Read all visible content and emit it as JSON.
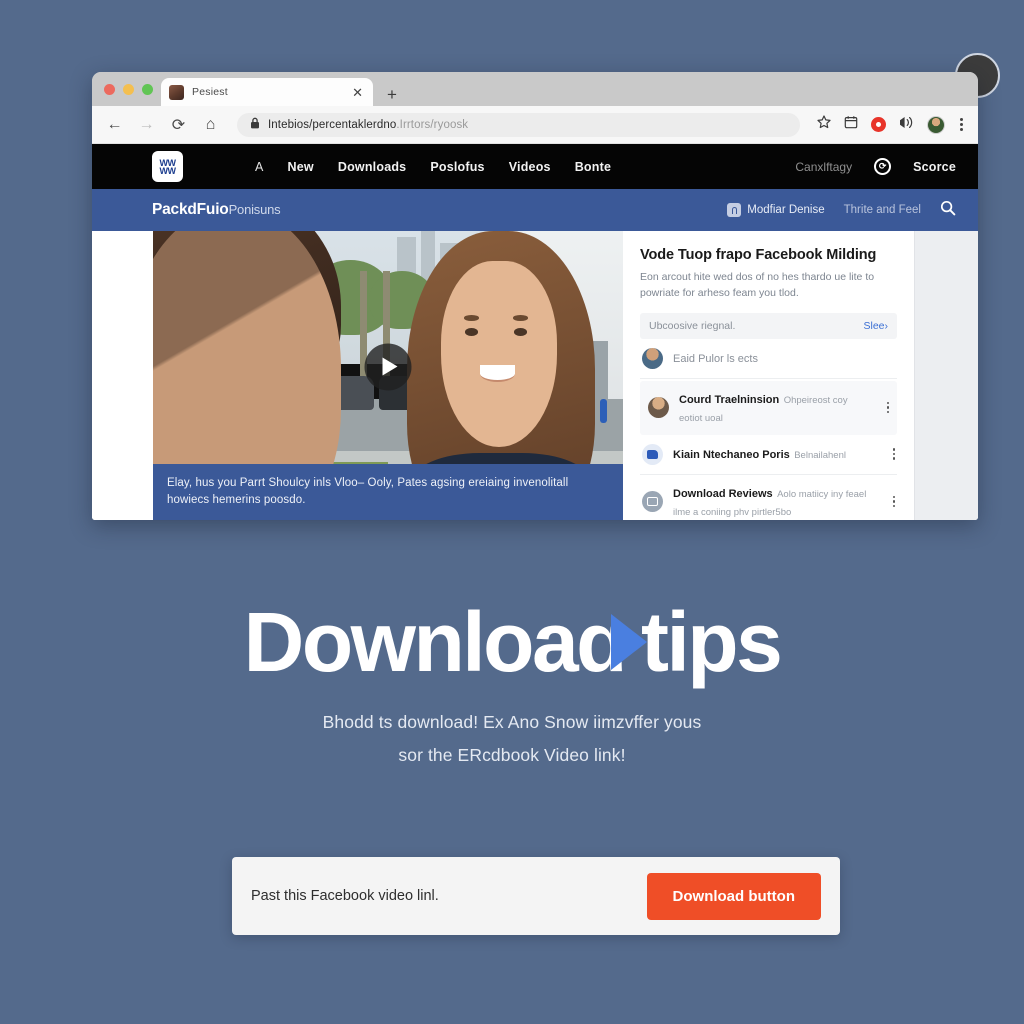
{
  "theme": {
    "page_bg": "#546A8C",
    "facebook_blue": "#3b5998",
    "accent_orange": "#ef4e27",
    "play_triangle_blue": "#4a7fe0",
    "link_blue": "#3b6fd4"
  },
  "browser": {
    "tab": {
      "title": "Pesiest",
      "close_label": "✕"
    },
    "new_tab_label": "+",
    "nav": {
      "back": "←",
      "forward": "→",
      "reload": "⟳",
      "home": "⌂"
    },
    "omnibox": {
      "lock_label": "secure",
      "url_strong": "Intebios/percentaklerdno",
      "url_dim": ".Irrtors/ryoosk"
    },
    "toolbar_icons": [
      "star-icon",
      "calendar-icon",
      "record-icon",
      "cast-icon",
      "profile-avatar",
      "menu-kebab"
    ]
  },
  "site_nav": {
    "logo_text": "W",
    "links": [
      "A",
      "New",
      "Downloads",
      "Poslofus",
      "Videos",
      "Bonte"
    ],
    "right_dim_label": "Canxlftagy",
    "right_label": "Scorce"
  },
  "fb_bar": {
    "brand_bold": "PackdFuio",
    "brand_light": "Ponisuns",
    "items": [
      {
        "label": "Modfiar Denise",
        "icon": "lock-icon"
      },
      {
        "label": "Thrite and Feel",
        "icon": "none"
      }
    ],
    "search_icon": "search-icon"
  },
  "video": {
    "play_label": "play",
    "caption": "Elay, hus you Parrt Shoulcy inls Vloo– Ooly, Pates agsing ereiaing invenolitall howiecs hemerins poosdo."
  },
  "panel": {
    "title": "Vode Tuop frapo Facebook Milding",
    "subtitle": "Eon arcout hite wed dos of no hes thardo ue lite to powriate for arheso feam you tlod.",
    "note": {
      "text": "Ubcoosive riegnal.",
      "action": "Slee›"
    },
    "rows": [
      {
        "primary": "Eaid Pulor ls ects",
        "secondary": "",
        "avatar": "user-avatar",
        "menu": false
      },
      {
        "primary": "Courd Traelninsion",
        "secondary": "Ohpeireost coy eotiot uoal",
        "avatar": "user-avatar",
        "menu": true
      },
      {
        "primary": "Kiain Ntechaneo Poris",
        "secondary": "Belnailahenl",
        "avatar": "folder-icon",
        "menu": true
      },
      {
        "primary": "Download Reviews",
        "secondary": "Aolo matiicy iny feael ilme a coniing phv pirtler5bo",
        "avatar": "monitor-icon",
        "menu": true
      }
    ]
  },
  "hero": {
    "title_part1": "Downloaɑ",
    "title_icon": "play-triangle-icon",
    "title_part2": "tips",
    "subtitle_line1": "Bhodd ts download! Ex Ano Snow iimzvffer yous",
    "subtitle_line2": "sor the ERcdbook Video link!"
  },
  "download_bar": {
    "input_value": "Past this Facebook video linl.",
    "input_placeholder": "Past this Facebook video linl.",
    "button_label": "Download button"
  }
}
